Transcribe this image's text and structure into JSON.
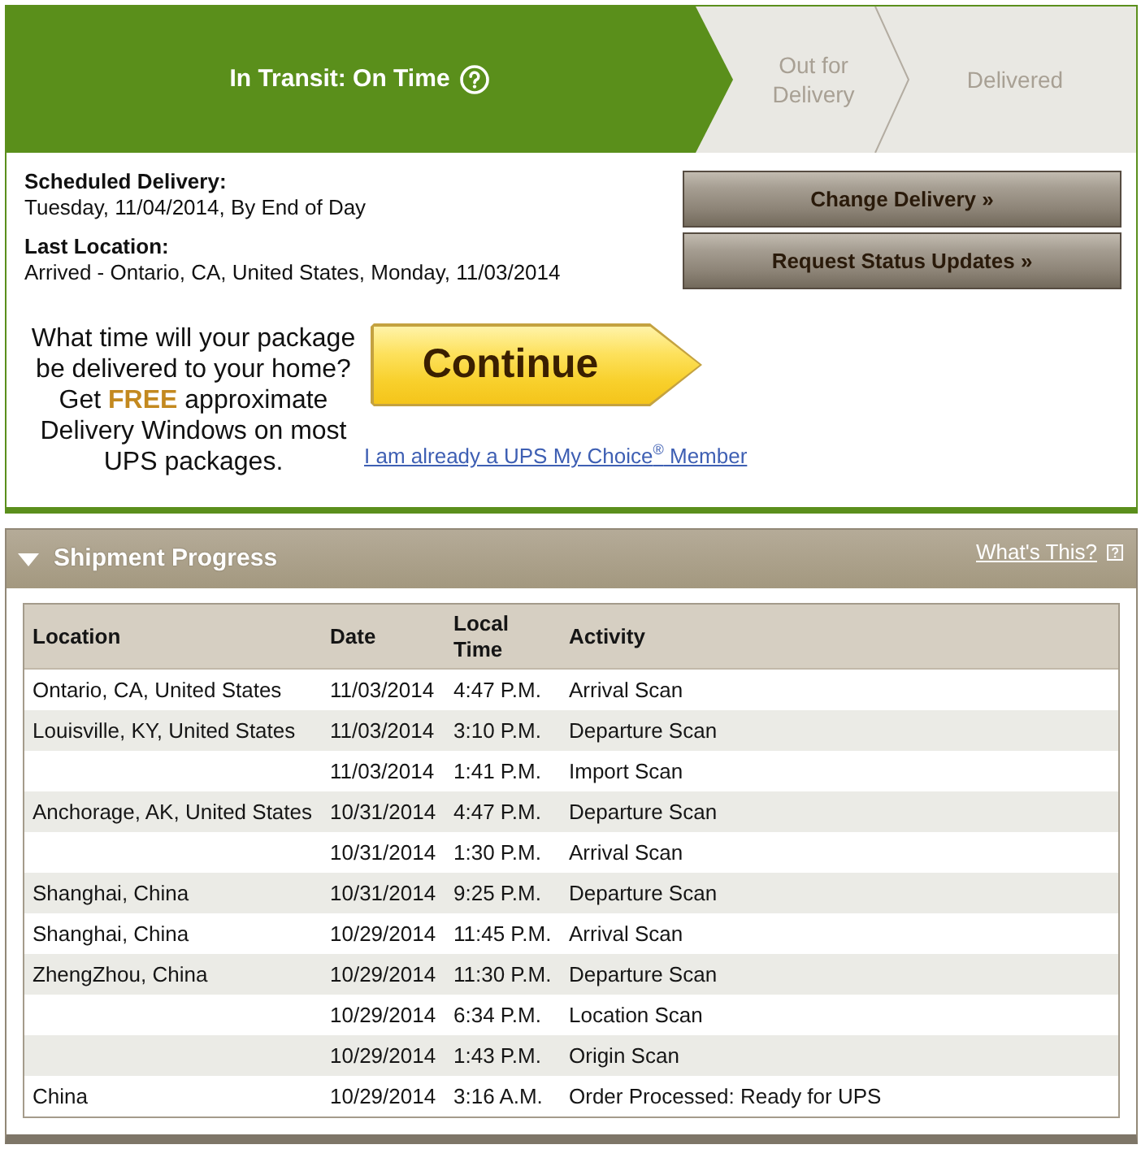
{
  "status_bar": {
    "steps": [
      {
        "label": "In Transit: On Time",
        "selected": true
      },
      {
        "label": "Out for Delivery",
        "selected": false
      },
      {
        "label": "Delivered",
        "selected": false
      }
    ]
  },
  "delivery_info": [
    {
      "label": "Scheduled Delivery:",
      "value": "Tuesday, 11/04/2014, By End of Day"
    },
    {
      "label": "Last Location:",
      "value": "Arrived - Ontario, CA, United States, Monday, 11/03/2014"
    }
  ],
  "actions": [
    "Change Delivery »",
    "Request Status Updates »"
  ],
  "promo": {
    "text": "What time will your package be delivered to your home? Get **FREE** approximate Delivery Windows on most UPS packages.",
    "button": "Continue",
    "link": "I am already a UPS My Choice$^{®}$ Member"
  },
  "shipment_progress": {
    "title": "Shipment Progress",
    "expanded": true,
    "help_link": "What's This?",
    "columns": [
      "Location",
      "Date",
      "Local Time",
      "Activity"
    ],
    "rows": [
      {
        "location": "Ontario, CA, United States",
        "date": "11/03/2014",
        "local_time": "4:47 P.M.",
        "activity": "Arrival Scan"
      },
      {
        "location": "Louisville, KY, United States",
        "date": "11/03/2014",
        "local_time": "3:10 P.M.",
        "activity": "Departure Scan"
      },
      {
        "date": "11/03/2014",
        "local_time": "1:41 P.M.",
        "activity": "Import Scan"
      },
      {
        "location": "Anchorage, AK, United States",
        "date": "10/31/2014",
        "local_time": "4:47 P.M.",
        "activity": "Departure Scan"
      },
      {
        "date": "10/31/2014",
        "local_time": "1:30 P.M.",
        "activity": "Arrival Scan"
      },
      {
        "location": "Shanghai, China",
        "date": "10/31/2014",
        "local_time": "9:25 P.M.",
        "activity": "Departure Scan"
      },
      {
        "location": "Shanghai, China",
        "date": "10/29/2014",
        "local_time": "11:45 P.M.",
        "activity": "Arrival Scan"
      },
      {
        "location": "ZhengZhou, China",
        "date": "10/29/2014",
        "local_time": "11:30 P.M.",
        "activity": "Departure Scan"
      },
      {
        "date": "10/29/2014",
        "local_time": "6:34 P.M.",
        "activity": "Location Scan"
      },
      {
        "date": "10/29/2014",
        "local_time": "1:43 P.M.",
        "activity": "Origin Scan"
      },
      {
        "location": "China",
        "date": "10/29/2014",
        "local_time": "3:16 A.M.",
        "activity": "Order Processed: Ready for UPS"
      }
    ]
  }
}
